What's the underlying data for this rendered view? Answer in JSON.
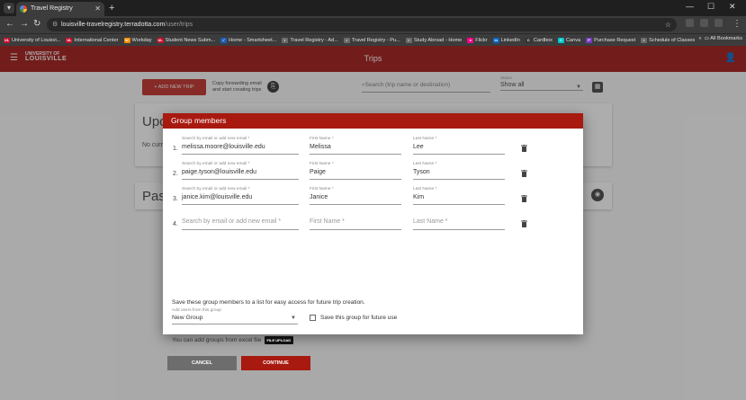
{
  "browser": {
    "tab_title": "Travel Registry",
    "url_host": "louisville-travelregistry.terradotta.com",
    "url_path": "/user/trips",
    "bookmarks": [
      {
        "label": "University of Louisvi...",
        "icon": "UL",
        "color": "#c8102e"
      },
      {
        "label": "International Center",
        "icon": "UL",
        "color": "#c8102e"
      },
      {
        "label": "Workday",
        "icon": "W",
        "color": "#f38b00"
      },
      {
        "label": "Student News Subm...",
        "icon": "UL",
        "color": "#c8102e"
      },
      {
        "label": "Home - Smartsheet...",
        "icon": "✓",
        "color": "#1f5fb8"
      },
      {
        "label": "Travel Registry - Ad...",
        "icon": "◐",
        "color": "#6b6b6b"
      },
      {
        "label": "Travel Registry - Pu...",
        "icon": "◐",
        "color": "#6b6b6b"
      },
      {
        "label": "Study Abroad - Home",
        "icon": "◐",
        "color": "#6b6b6b"
      },
      {
        "label": "Flickr",
        "icon": "●",
        "color": "#ff0084"
      },
      {
        "label": "LinkedIn",
        "icon": "in",
        "color": "#0a66c2"
      },
      {
        "label": "Cardbox",
        "icon": "C",
        "color": "#333333"
      },
      {
        "label": "Canva",
        "icon": "C",
        "color": "#00c4cc"
      },
      {
        "label": "Purchase Request",
        "icon": "P",
        "color": "#7a3cc0"
      },
      {
        "label": "Schedule of Classes",
        "icon": "◐",
        "color": "#6b6b6b"
      }
    ],
    "all_bookmarks": "All Bookmarks"
  },
  "app": {
    "logo_top": "UNIVERSITY OF",
    "logo_main": "LOUISVILLE",
    "page_title": "Trips",
    "add_trip": "+ ADD NEW TRIP",
    "copy_line1": "Copy forwarding email",
    "copy_line2": "and start creating trips",
    "search_placeholder": "Search (trip name or destination)",
    "status_label": "Status",
    "status_value": "Show all",
    "upcoming_heading": "Upc",
    "upcoming_text": "No curr",
    "past_heading": "Pas"
  },
  "modal": {
    "title": "Group members",
    "email_label": "Search by email or add new email *",
    "first_label": "First Name *",
    "last_label": "Last Name *",
    "rows": [
      {
        "num": "1.",
        "email": "melissa.moore@louisville.edu",
        "first": "Melissa",
        "last": "Lee"
      },
      {
        "num": "2.",
        "email": "paige.tyson@louisville.edu",
        "first": "Paige",
        "last": "Tyson"
      },
      {
        "num": "3.",
        "email": "janice.kim@louisville.edu",
        "first": "Janice",
        "last": "Kim"
      }
    ],
    "empty_row": {
      "num": "4.",
      "email_placeholder": "Search by email or add new email *",
      "first_placeholder": "First Name *",
      "last_placeholder": "Last Name *"
    },
    "save_text": "Save these group members to a list for easy access for future trip creation.",
    "add_users_label": "Add users from this group",
    "group_value": "New Group",
    "save_checkbox": "Save this group for future use",
    "excel_text": "You can add groups from excel file",
    "file_upload": "FILE UPLOAD",
    "cancel": "CANCEL",
    "continue": "CONTINUE"
  },
  "colors": {
    "header": "#a82c28",
    "modal_header": "#a8190f",
    "cancel": "#6d6d6d"
  }
}
